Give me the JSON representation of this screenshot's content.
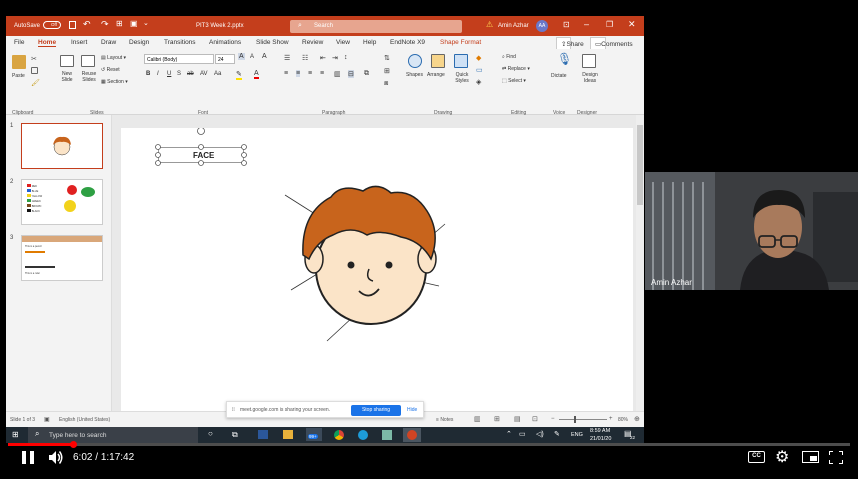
{
  "ppt": {
    "autosave_label": "AutoSave",
    "autosave_state": "Off",
    "file_title": "PIT3 Week 2.pptx",
    "search_placeholder": "Search",
    "user_name": "Amin Azhar",
    "user_initials": "AA",
    "menu": [
      "File",
      "Home",
      "Insert",
      "Draw",
      "Design",
      "Transitions",
      "Animations",
      "Slide Show",
      "Review",
      "View",
      "Help",
      "EndNote X9",
      "Shape Format"
    ],
    "share_label": "Share",
    "comments_label": "Comments",
    "ribbon": {
      "paste": "Paste",
      "new_slide": "New Slide",
      "reuse_slides": "Reuse Slides",
      "layout": "Layout",
      "reset": "Reset",
      "section": "Section",
      "font_name": "Calibri (Body)",
      "font_size": "24",
      "shapes": "Shapes",
      "arrange": "Arrange",
      "quick_styles": "Quick Styles",
      "find": "Find",
      "replace": "Replace",
      "select": "Select",
      "dictate": "Dictate",
      "design_ideas": "Design Ideas",
      "groups": [
        "Clipboard",
        "Slides",
        "Font",
        "Paragraph",
        "Drawing",
        "Editing",
        "Voice",
        "Designer"
      ]
    },
    "slide_numbers": [
      "1",
      "2",
      "3"
    ],
    "slide2_colors": [
      "RED",
      "BLUE",
      "YELLOW",
      "GREEN",
      "BROWN",
      "BLACK"
    ],
    "slide3_lines": [
      "This is a pencil",
      "This is a ruler"
    ],
    "slide_text": "FACE",
    "status": {
      "slide_of": "Slide 1 of 3",
      "language": "English (United States)",
      "notes": "Notes",
      "zoom": "80%"
    }
  },
  "webcam": {
    "name": "Amin Azhar"
  },
  "share_banner": {
    "message": "meet.google.com is sharing your screen.",
    "stop": "Stop sharing",
    "hide": "Hide"
  },
  "taskbar": {
    "search_placeholder": "Type here to search",
    "badge": "99+",
    "lang": "ENG",
    "time": "8:59 AM",
    "date": "21/01/20",
    "notif": "22"
  },
  "player": {
    "current_time": "6:02",
    "duration": "1:17:42",
    "time_sep": " / ",
    "progress": 0.0775,
    "cc_label": "CC"
  },
  "colors": {
    "ppt_accent": "#c43e1c",
    "progress": "#ff0000"
  }
}
